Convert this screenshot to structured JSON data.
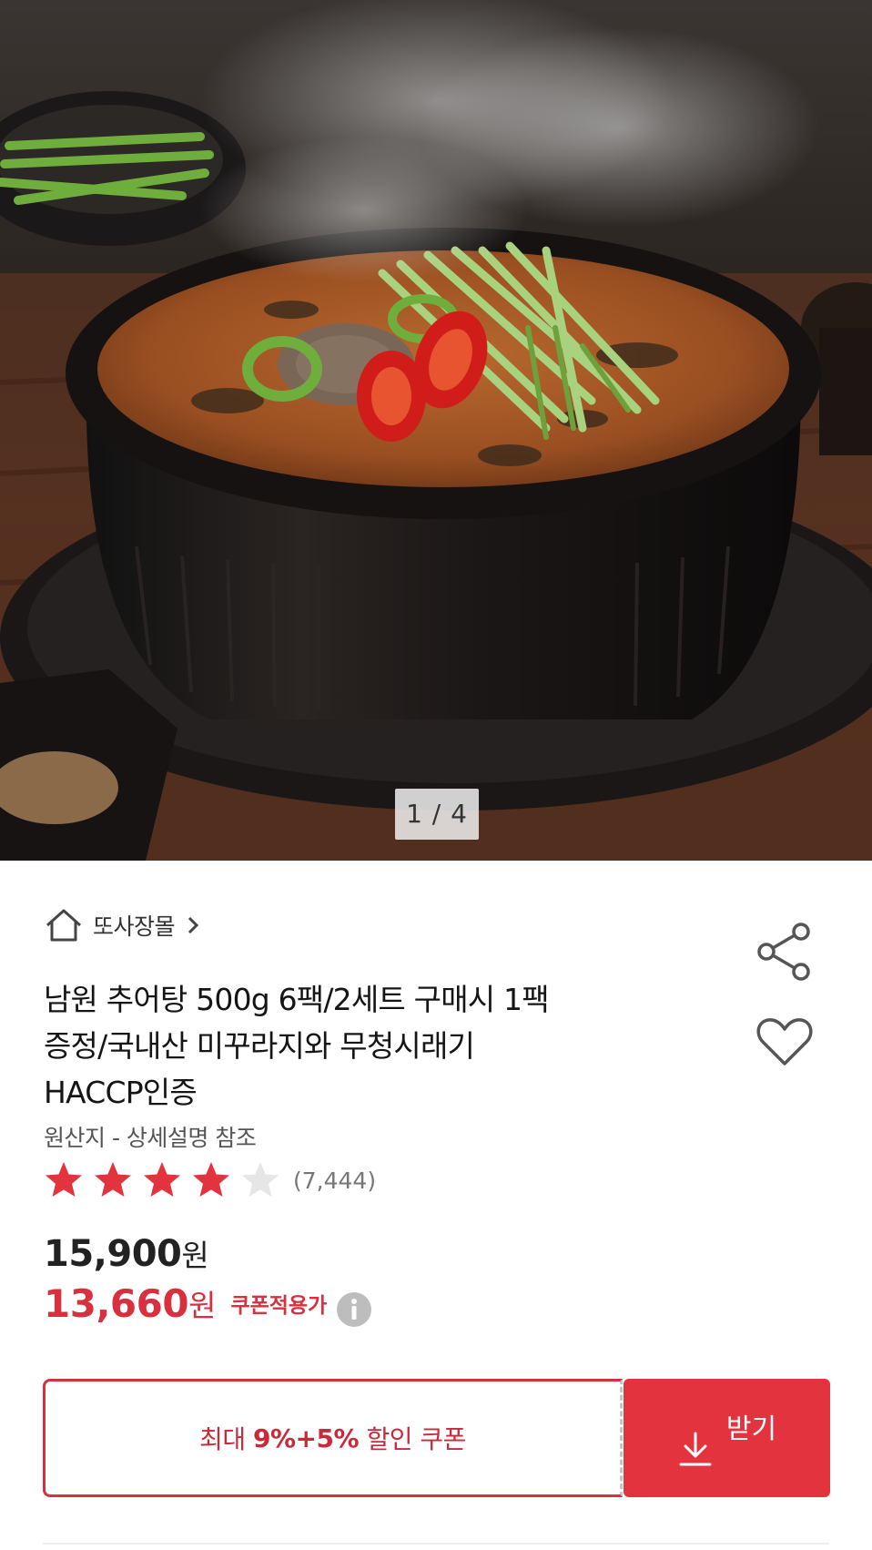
{
  "hero": {
    "pager_text": "1 / 4"
  },
  "store": {
    "name": "또사장몰"
  },
  "product": {
    "title_lines": [
      "남원 추어탕 500g 6팩/2세트 구매시 1팩",
      "증정/국내산 미꾸라지와 무청시래기",
      "HACCP인증"
    ],
    "origin": "원산지 - 상세설명 참조",
    "rating_value": 4.5,
    "rating_count": "(7,444)"
  },
  "price": {
    "original_amount": "15,900",
    "original_unit": "원",
    "sale_amount": "13,660",
    "sale_unit": "원",
    "sale_label": "쿠폰적용가"
  },
  "coupon": {
    "text_prefix": "최대 ",
    "text_strong": "9%+5%",
    "text_suffix": " 할인 쿠폰",
    "button_label": "받기"
  },
  "colors": {
    "accent": "#e2333f",
    "accent_text": "#d8303f"
  }
}
